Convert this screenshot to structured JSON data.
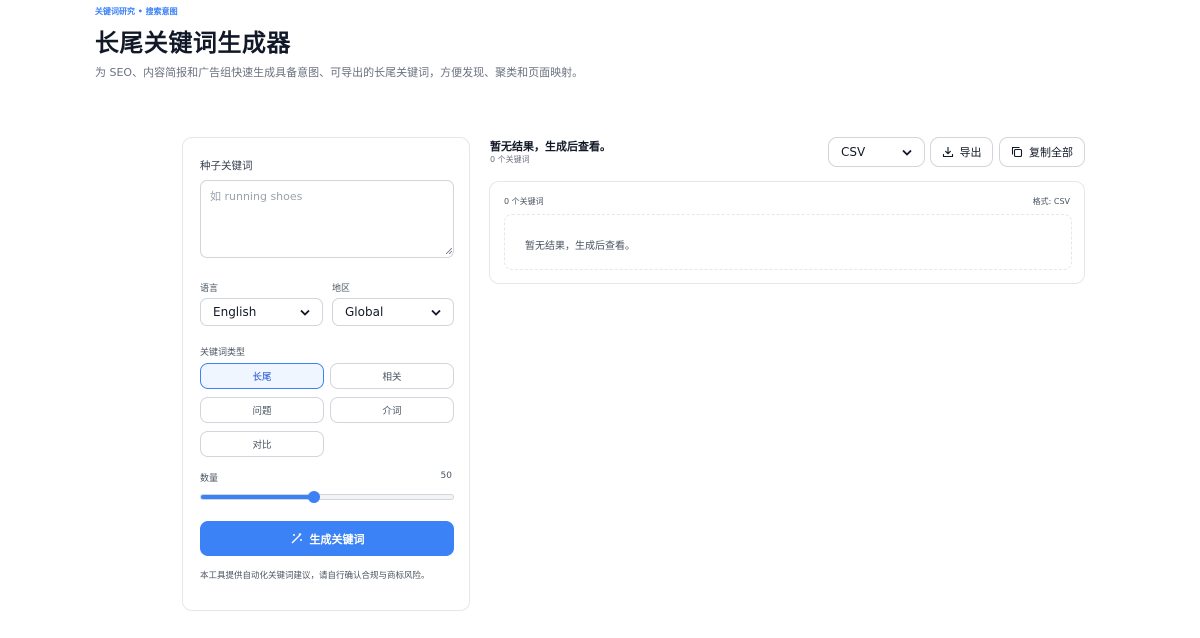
{
  "header": {
    "eyebrow": "关键词研究 • 搜索意图",
    "title": "长尾关键词生成器",
    "description": "为 SEO、内容简报和广告组快速生成具备意图、可导出的长尾关键词，方便发现、聚类和页面映射。"
  },
  "form": {
    "seed_label": "种子关键词",
    "seed_placeholder": "如 running shoes",
    "seed_value": "",
    "language_label": "语言",
    "language_value": "English",
    "region_label": "地区",
    "region_value": "Global",
    "type_label": "关键词类型",
    "types": [
      {
        "label": "长尾",
        "active": true
      },
      {
        "label": "相关",
        "active": false
      },
      {
        "label": "问题",
        "active": false
      },
      {
        "label": "介词",
        "active": false
      },
      {
        "label": "对比",
        "active": false
      }
    ],
    "quantity_label": "数量",
    "quantity_value": "50",
    "quantity_fraction": 0.45,
    "generate_label": "生成关键词",
    "disclaimer": "本工具提供自动化关键词建议，请自行确认合规与商标风险。"
  },
  "results": {
    "title": "暂无结果，生成后查看。",
    "count_label": "0 个关键词",
    "format_value": "CSV",
    "export_label": "导出",
    "copy_all_label": "复制全部",
    "card_count_label": "0 个关键词",
    "card_format_label": "格式: CSV",
    "empty_message": "暂无结果，生成后查看。"
  },
  "colors": {
    "accent": "#3b82f6",
    "accent_soft": "#eff6ff"
  },
  "icons": [
    "chevron-down-icon",
    "wand-icon",
    "download-icon",
    "copy-icon"
  ]
}
